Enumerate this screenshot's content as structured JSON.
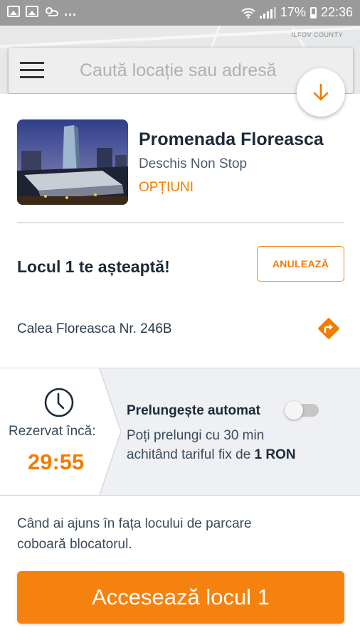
{
  "status_bar": {
    "battery": "17%",
    "time": "22:36",
    "dots": "..."
  },
  "map": {
    "region_label": "ILFOV COUNTY"
  },
  "search": {
    "placeholder": "Caută locație sau adresă"
  },
  "location": {
    "name": "Promenada Floreasca",
    "hours": "Deschis Non Stop",
    "options_label": "OPȚIUNI",
    "address": "Calea Floreasca Nr. 246B"
  },
  "reservation": {
    "spot_message": "Locul 1 te așteaptă!",
    "cancel_label": "ANULEAZĂ",
    "reserved_label": "Rezervat încă:",
    "timer": "29:55",
    "auto_extend_label": "Prelungește automat",
    "auto_extend_on": false,
    "extend_text_1": "Poți prelungi cu 30 min",
    "extend_text_2": "achitând tariful fix de",
    "extend_price": "1 RON"
  },
  "instructions": {
    "line1": "Când ai ajuns în fața locului de parcare",
    "line2": "coboară blocatorul."
  },
  "actions": {
    "access_label": "Accesează locul 1"
  },
  "colors": {
    "accent": "#f5820f",
    "text_dark": "#1b2a3a",
    "status_bar": "#9a9a9a"
  },
  "icons": {
    "menu": "menu-icon",
    "collapse": "arrow-down-icon",
    "directions": "directions-icon",
    "clock": "clock-icon"
  }
}
